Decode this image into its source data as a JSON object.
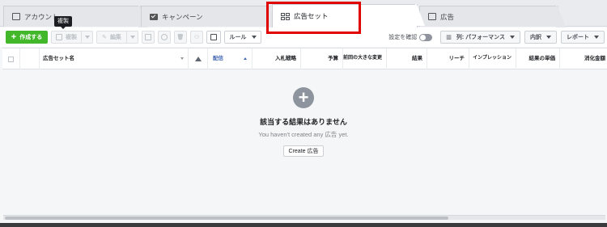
{
  "tabs": [
    {
      "label": "アカウント",
      "icon": "account-icon"
    },
    {
      "label": "キャンペーン",
      "icon": "campaign-icon"
    },
    {
      "label": "広告セット",
      "icon": "adset-grid-icon",
      "active": true
    },
    {
      "label": "広告",
      "icon": "ad-icon"
    }
  ],
  "tooltip": "複製",
  "toolbar": {
    "create_label": "作成する",
    "duplicate_label": "複製",
    "edit_label": "編集",
    "rules_label": "ルール",
    "compare_settings_label": "設定を確認",
    "columns_label": "列: パフォーマンス",
    "breakdown_label": "内訳",
    "report_label": "レポート"
  },
  "table": {
    "columns": [
      "広告セット名",
      "配信",
      "入札戦略",
      "予算",
      "前回の大きな変更",
      "結果",
      "リーチ",
      "インプレッション",
      "結果の単価",
      "消化金額"
    ]
  },
  "empty_state": {
    "title": "該当する結果はありません",
    "subtitle": "You haven't created any 広告 yet.",
    "button_label": "Create 広告"
  },
  "colors": {
    "create_green": "#42b72a",
    "link_blue": "#4267b2",
    "highlight_red": "#e00000"
  }
}
